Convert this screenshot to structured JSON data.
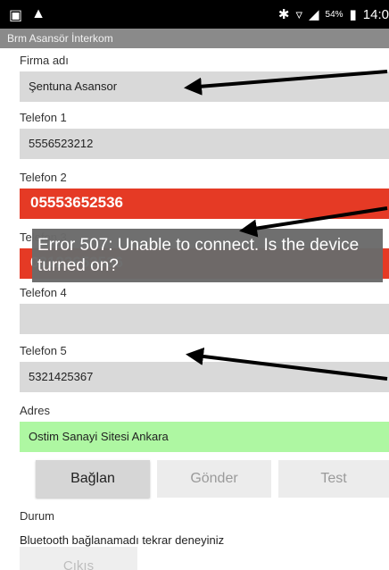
{
  "status_bar": {
    "left_icons": [
      "image-icon",
      "warning-icon"
    ],
    "right_icons": [
      "bluetooth-icon",
      "wifi-icon",
      "signal-icon"
    ],
    "battery": "54%",
    "time": "14:0"
  },
  "app": {
    "title": "Brm Asansör İnterkom"
  },
  "form": {
    "firma_label": "Firma adı",
    "firma_value": "Şentuna Asansor",
    "tel1_label": "Telefon 1",
    "tel1_value": "5556523212",
    "tel2_label": "Telefon 2",
    "tel2_value": "05553652536",
    "tel3_label": "Telefon 3",
    "tel3_value": "03123652536",
    "tel4_label": "Telefon 4",
    "tel5_label": "Telefon 5",
    "tel5_value": "5321425367",
    "adres_label": "Adres",
    "adres_value": "Ostim Sanayi Sitesi   Ankara"
  },
  "buttons": {
    "connect": "Bağlan",
    "send": "Gönder",
    "test": "Test",
    "exit": "Çıkış"
  },
  "durum": {
    "label": "Durum",
    "message": "Bluetooth bağlanamadı tekrar deneyiniz"
  },
  "toast": {
    "message": "Error 507: Unable to connect. Is the device turned on?"
  },
  "colors": {
    "error_field": "#e53a25",
    "address_field": "#aef7a2",
    "toast_bg": "#6b6b6b",
    "annotation_arrow": "#000000"
  }
}
